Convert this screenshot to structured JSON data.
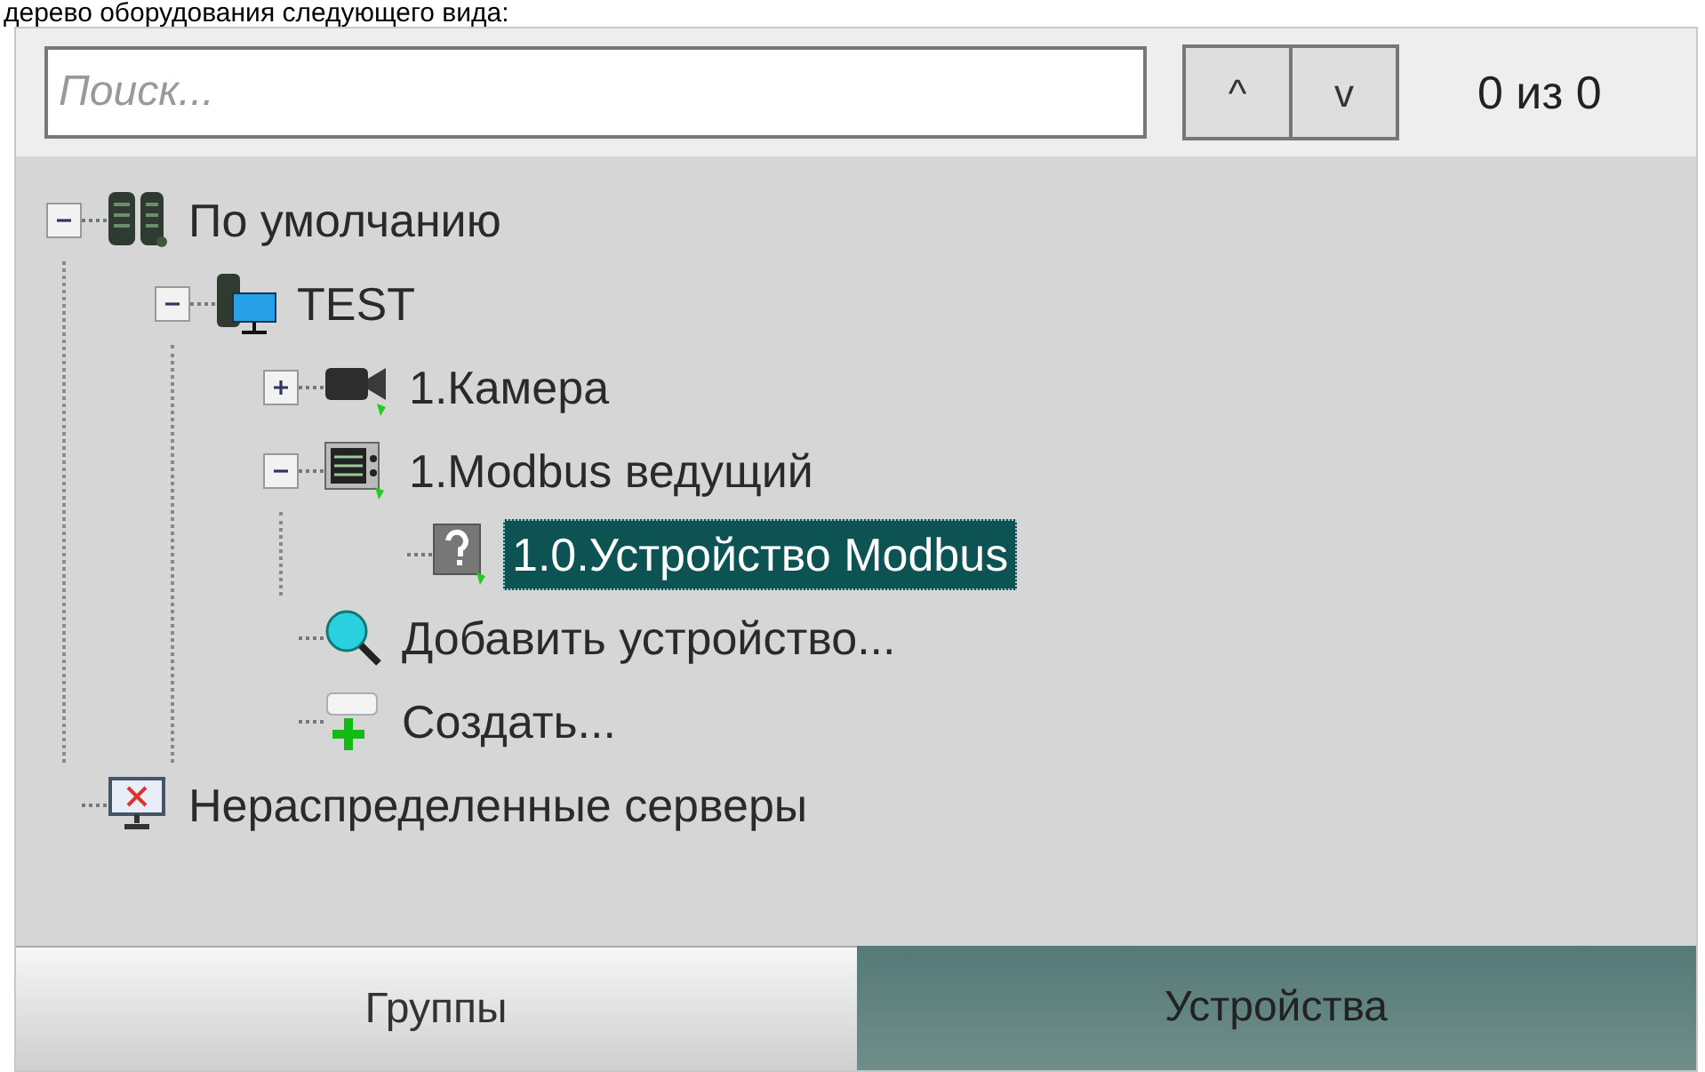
{
  "caption": "дерево оборудования следующего вида:",
  "search": {
    "placeholder": "Поиск...",
    "prev": "^",
    "next": "v",
    "counter": "0 из 0"
  },
  "tree": [
    {
      "kind": "server-group",
      "label": "По умолчанию",
      "expanded": true,
      "selected": false,
      "children": [
        {
          "kind": "server",
          "label": "TEST",
          "expanded": true,
          "selected": false,
          "children": [
            {
              "kind": "camera",
              "label": "1.Камера",
              "expanded": false,
              "selected": false
            },
            {
              "kind": "modbus",
              "label": "1.Modbus ведущий",
              "expanded": true,
              "selected": false,
              "children": [
                {
                  "kind": "unknown",
                  "label": "1.0.Устройство Modbus",
                  "selected": true
                }
              ]
            },
            {
              "kind": "add",
              "label": "Добавить устройство...",
              "selected": false
            },
            {
              "kind": "create",
              "label": "Создать...",
              "selected": false
            }
          ]
        }
      ]
    },
    {
      "kind": "unassigned",
      "label": "Нераспределенные серверы",
      "selected": false
    }
  ],
  "tabs": [
    {
      "label": "Группы",
      "selected": false
    },
    {
      "label": "Устройства",
      "selected": true
    }
  ]
}
